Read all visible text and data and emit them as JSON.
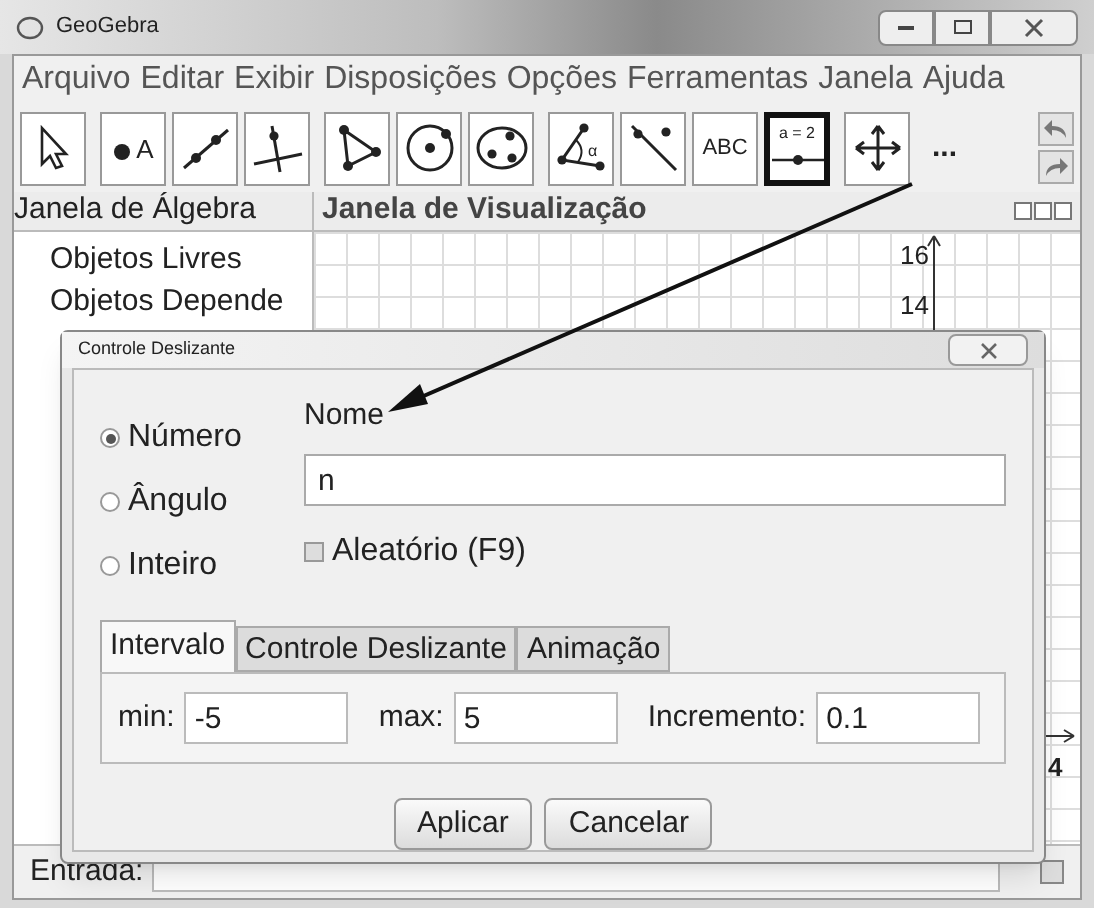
{
  "window": {
    "title": "GeoGebra"
  },
  "menu": [
    "Arquivo",
    "Editar",
    "Exibir",
    "Disposições",
    "Opções",
    "Ferramentas",
    "Janela",
    "Ajuda"
  ],
  "tools": [
    {
      "kind": "move",
      "selected": false
    },
    {
      "kind": "point",
      "label": "A",
      "selected": false
    },
    {
      "kind": "line",
      "selected": false
    },
    {
      "kind": "perpendicular",
      "selected": false
    },
    {
      "kind": "polygon",
      "selected": false
    },
    {
      "kind": "circle",
      "selected": false
    },
    {
      "kind": "conic",
      "selected": false
    },
    {
      "kind": "angle",
      "label": "α",
      "selected": false
    },
    {
      "kind": "reflect",
      "selected": false
    },
    {
      "kind": "text",
      "label": "ABC",
      "selected": false
    },
    {
      "kind": "slider",
      "label": "a = 2",
      "selected": true
    },
    {
      "kind": "pan",
      "selected": false
    }
  ],
  "more_tools": "...",
  "algebra_view": {
    "title": "Janela de Álgebra",
    "items": [
      "Objetos Livres",
      "Objetos Depende"
    ]
  },
  "graphics_view": {
    "title": "Janela de Visualização",
    "y_labels": [
      "16",
      "14"
    ],
    "x_label": "4"
  },
  "dialog": {
    "title": "Controle Deslizante",
    "types": [
      {
        "label": "Número",
        "selected": true
      },
      {
        "label": "Ângulo",
        "selected": false
      },
      {
        "label": "Inteiro",
        "selected": false
      }
    ],
    "name_label": "Nome",
    "name_value": "n",
    "random": {
      "label": "Aleatório (F9)",
      "checked": false
    },
    "tabs": [
      {
        "label": "Intervalo",
        "selected": true
      },
      {
        "label": "Controle Deslizante",
        "selected": false
      },
      {
        "label": "Animação",
        "selected": false
      }
    ],
    "fields": [
      {
        "label": "min:",
        "value": "-5"
      },
      {
        "label": "max:",
        "value": "5"
      },
      {
        "label": "Incremento:",
        "value": "0.1"
      }
    ],
    "buttons": [
      "Aplicar",
      "Cancelar"
    ]
  },
  "input_bar": {
    "label": "Entrada:"
  }
}
